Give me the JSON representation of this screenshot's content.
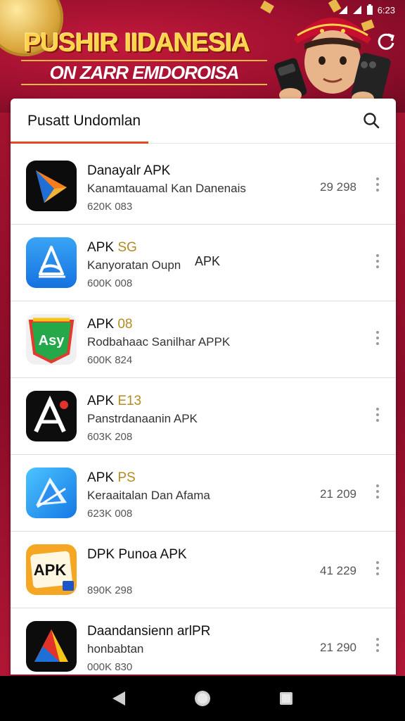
{
  "status_bar": {
    "time": "6:23"
  },
  "banner": {
    "title": "PUSHIR IIDANESIA",
    "subtitle": "ON ZARR EMDOROISA"
  },
  "header": {
    "title": "Pusatt Undomlan"
  },
  "apps": [
    {
      "title": "Danayalr APK",
      "tag": "",
      "extra": "",
      "subtitle": "Kanamtauamal Kan Danenais",
      "meta": "620K 083",
      "count": "29 298",
      "icon": "arrow-logo-icon"
    },
    {
      "title": "APK ",
      "tag": "SG",
      "extra": "APK",
      "subtitle": "Kanyoratan Oupn",
      "meta": "600K 008",
      "count": "",
      "icon": "blue-a-logo-icon"
    },
    {
      "title": "APK ",
      "tag": "08",
      "extra": "",
      "subtitle": "Rodbahaac Sanilhar APPK",
      "meta": "600K 824",
      "count": "",
      "icon": "green-asy-logo-icon"
    },
    {
      "title": "APK ",
      "tag": "E13",
      "extra": "",
      "subtitle": "Panstrdanaanin APK",
      "meta": "603K 208",
      "count": "",
      "icon": "black-a-logo-icon"
    },
    {
      "title": "APK ",
      "tag": "PS",
      "extra": "",
      "subtitle": "Keraaitalan Dan Afama",
      "meta": "623K 008",
      "count": "21 209",
      "icon": "blue-arrow-logo-icon"
    },
    {
      "title": "DPK Punoa APK",
      "tag": "",
      "extra": "",
      "subtitle": "",
      "meta": "890K 298",
      "count": "41 229",
      "icon": "apk-badge-logo-icon"
    },
    {
      "title": "Daandansienn arlPR",
      "tag": "",
      "extra": "",
      "subtitle": "honbabtan",
      "meta": "000K 830",
      "count": "21 290",
      "icon": "triangle-logo-icon"
    }
  ],
  "icon_badges": {
    "apk_badge_text": "APK",
    "asy_text": "Asy"
  },
  "colors": {
    "accent": "#e3491f",
    "banner_red": "#9b0f2e",
    "gold": "#ffd34a"
  }
}
